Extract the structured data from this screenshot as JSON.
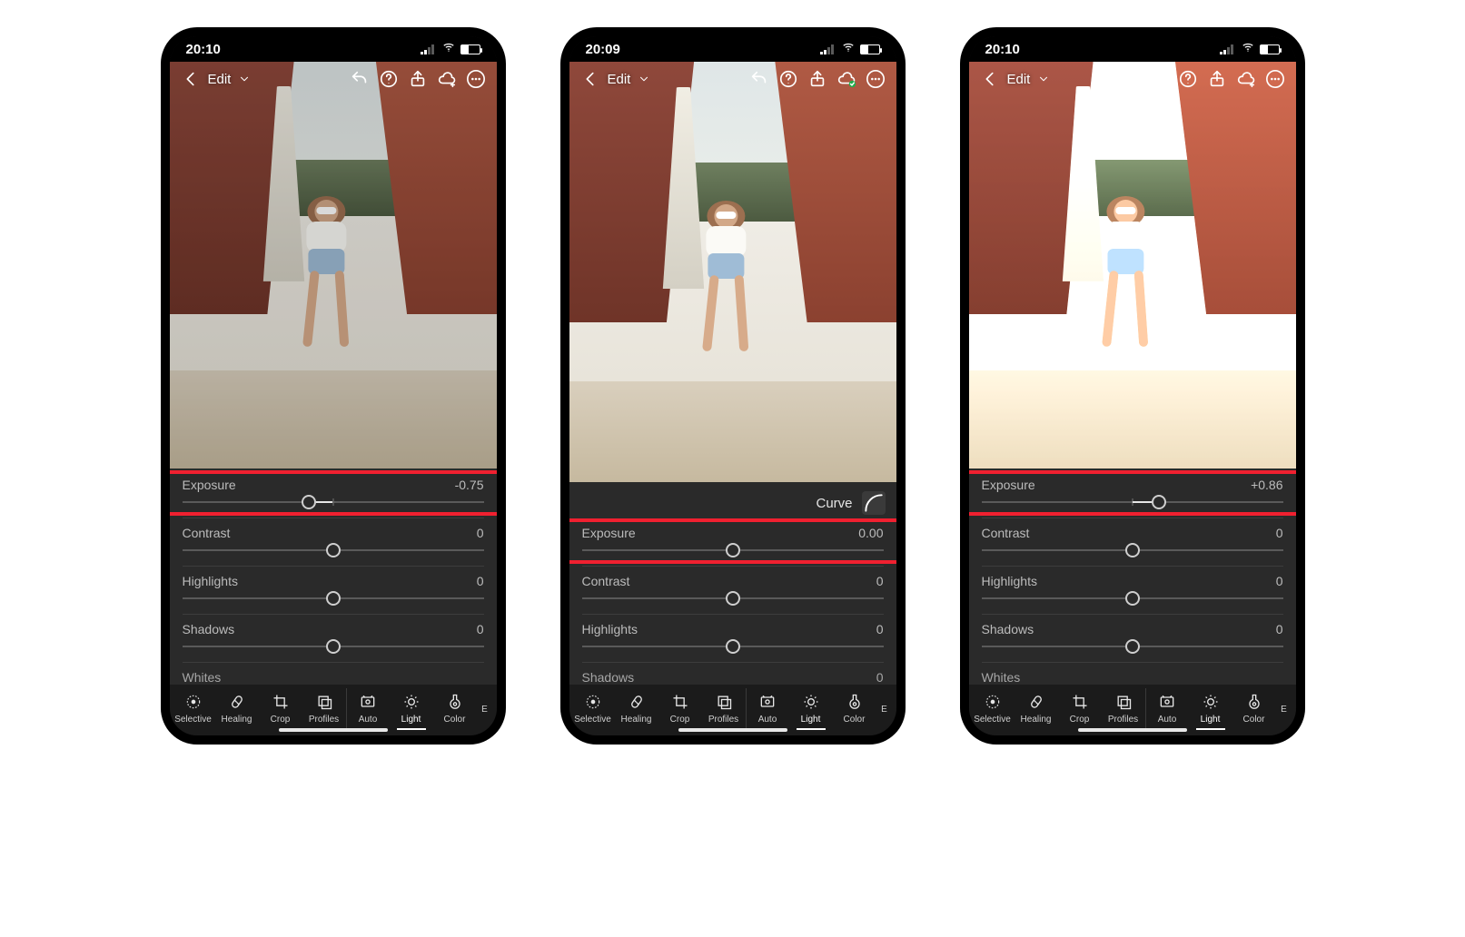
{
  "colors": {
    "highlight_red": "#f02030"
  },
  "toolbar_labels": {
    "selective": "Selective",
    "healing": "Healing",
    "crop": "Crop",
    "profiles": "Profiles",
    "auto": "Auto",
    "light": "Light",
    "color": "Color",
    "more_letter": "E"
  },
  "header": {
    "edit_label": "Edit"
  },
  "curve_label": "Curve",
  "settings_labels": {
    "exposure": "Exposure",
    "contrast": "Contrast",
    "highlights": "Highlights",
    "shadows": "Shadows",
    "whites": "Whites"
  },
  "phones": [
    {
      "time": "20:10",
      "cloud_status": "plus",
      "show_curve_row": false,
      "exposure_value": "-0.75",
      "exposure_pos_pct": 42,
      "brightness_css": "brightness(0.85)",
      "sliders": [
        {
          "label_key": "contrast",
          "value": "0",
          "pos_pct": 50
        },
        {
          "label_key": "highlights",
          "value": "0",
          "pos_pct": 50
        },
        {
          "label_key": "shadows",
          "value": "0",
          "pos_pct": 50
        }
      ],
      "partial_row_label_key": "whites"
    },
    {
      "time": "20:09",
      "cloud_status": "check",
      "show_curve_row": true,
      "exposure_value": "0.00",
      "exposure_pos_pct": 50,
      "brightness_css": "brightness(1.0)",
      "sliders": [
        {
          "label_key": "contrast",
          "value": "0",
          "pos_pct": 50
        },
        {
          "label_key": "highlights",
          "value": "0",
          "pos_pct": 50
        }
      ],
      "partial_row_label_key": "shadows",
      "partial_row_value": "0"
    },
    {
      "time": "20:10",
      "cloud_status": "plus",
      "show_curve_row": false,
      "exposure_value": "+0.86",
      "exposure_pos_pct": 59,
      "brightness_css": "brightness(1.2)",
      "sliders": [
        {
          "label_key": "contrast",
          "value": "0",
          "pos_pct": 50
        },
        {
          "label_key": "highlights",
          "value": "0",
          "pos_pct": 50
        },
        {
          "label_key": "shadows",
          "value": "0",
          "pos_pct": 50
        }
      ],
      "partial_row_label_key": "whites"
    }
  ]
}
